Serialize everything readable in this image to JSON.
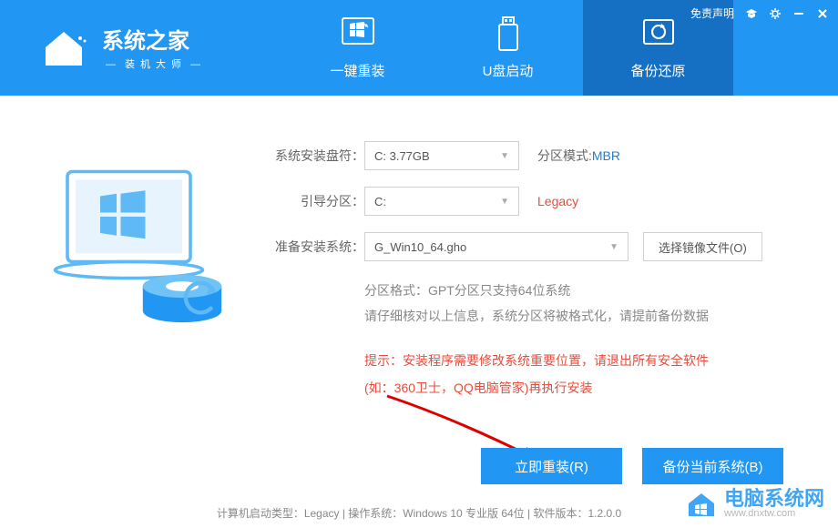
{
  "header": {
    "logo_title": "系统之家",
    "logo_subtitle": "装机大师",
    "free_statement": "免责声明"
  },
  "tabs": [
    {
      "label": "一键重装"
    },
    {
      "label": "U盘启动"
    },
    {
      "label": "备份还原"
    }
  ],
  "form": {
    "drive_label": "系统安装盘符：",
    "drive_value": "C: 3.77GB",
    "partition_mode_label": "分区模式:",
    "partition_mode_value": "MBR",
    "boot_label": "引导分区：",
    "boot_value": "C:",
    "boot_type": "Legacy",
    "system_label": "准备安装系统：",
    "system_value": "G_Win10_64.gho",
    "file_button": "选择镜像文件(O)"
  },
  "info": {
    "line1": "分区格式：GPT分区只支持64位系统",
    "line2": "请仔细核对以上信息，系统分区将被格式化，请提前备份数据"
  },
  "warning": {
    "line1": "提示：安装程序需要修改系统重要位置，请退出所有安全软件",
    "line2": "(如：360卫士，QQ电脑管家)再执行安装"
  },
  "actions": {
    "reinstall": "立即重装(R)",
    "backup": "备份当前系统(B)"
  },
  "status": "计算机启动类型：Legacy | 操作系统：Windows 10 专业版 64位 | 软件版本：1.2.0.0",
  "watermark": {
    "title": "电脑系统网",
    "url": "www.dnxtw.com"
  }
}
